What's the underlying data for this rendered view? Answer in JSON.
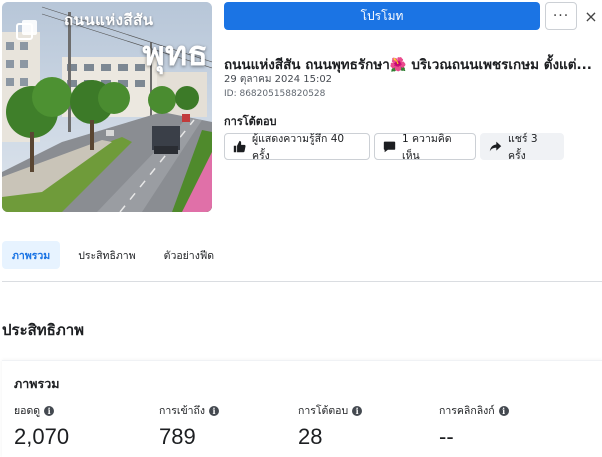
{
  "thumbnail": {
    "caption_small": "ถนนแห่งสีสัน",
    "caption_large": "พุทธ"
  },
  "header": {
    "promote_label": "โปรโมท",
    "more_label": "···",
    "close_label": "×"
  },
  "post": {
    "title": "ถนนแห่งสีสัน ถนนพุทธรักษา🌺 บริเวณถนนเพชรเกษม ตั้งแต่...",
    "date": "29 ตุลาคม 2024 15:02",
    "id": "ID: 868205158820528"
  },
  "engagement": {
    "label": "การโต้ตอบ",
    "reactions": "ผู้แสดงความรู้สึก 40 ครั้ง",
    "comments": "1 ความคิดเห็น",
    "shares": "แชร์ 3 ครั้ง"
  },
  "tabs": [
    {
      "label": "ภาพรวม",
      "active": true
    },
    {
      "label": "ประสิทธิภาพ",
      "active": false
    },
    {
      "label": "ตัวอย่างฟีด",
      "active": false
    }
  ],
  "performance": {
    "section_title": "ประสิทธิภาพ",
    "card_title": "ภาพรวม",
    "metrics": [
      {
        "label": "ยอดดู",
        "value": "2,070"
      },
      {
        "label": "การเข้าถึง",
        "value": "789"
      },
      {
        "label": "การโต้ตอบ",
        "value": "28"
      },
      {
        "label": "การคลิกลิงก์",
        "value": "--"
      }
    ]
  },
  "colors": {
    "accent": "#1b74e4",
    "active_tab_bg": "#e7f3ff"
  }
}
